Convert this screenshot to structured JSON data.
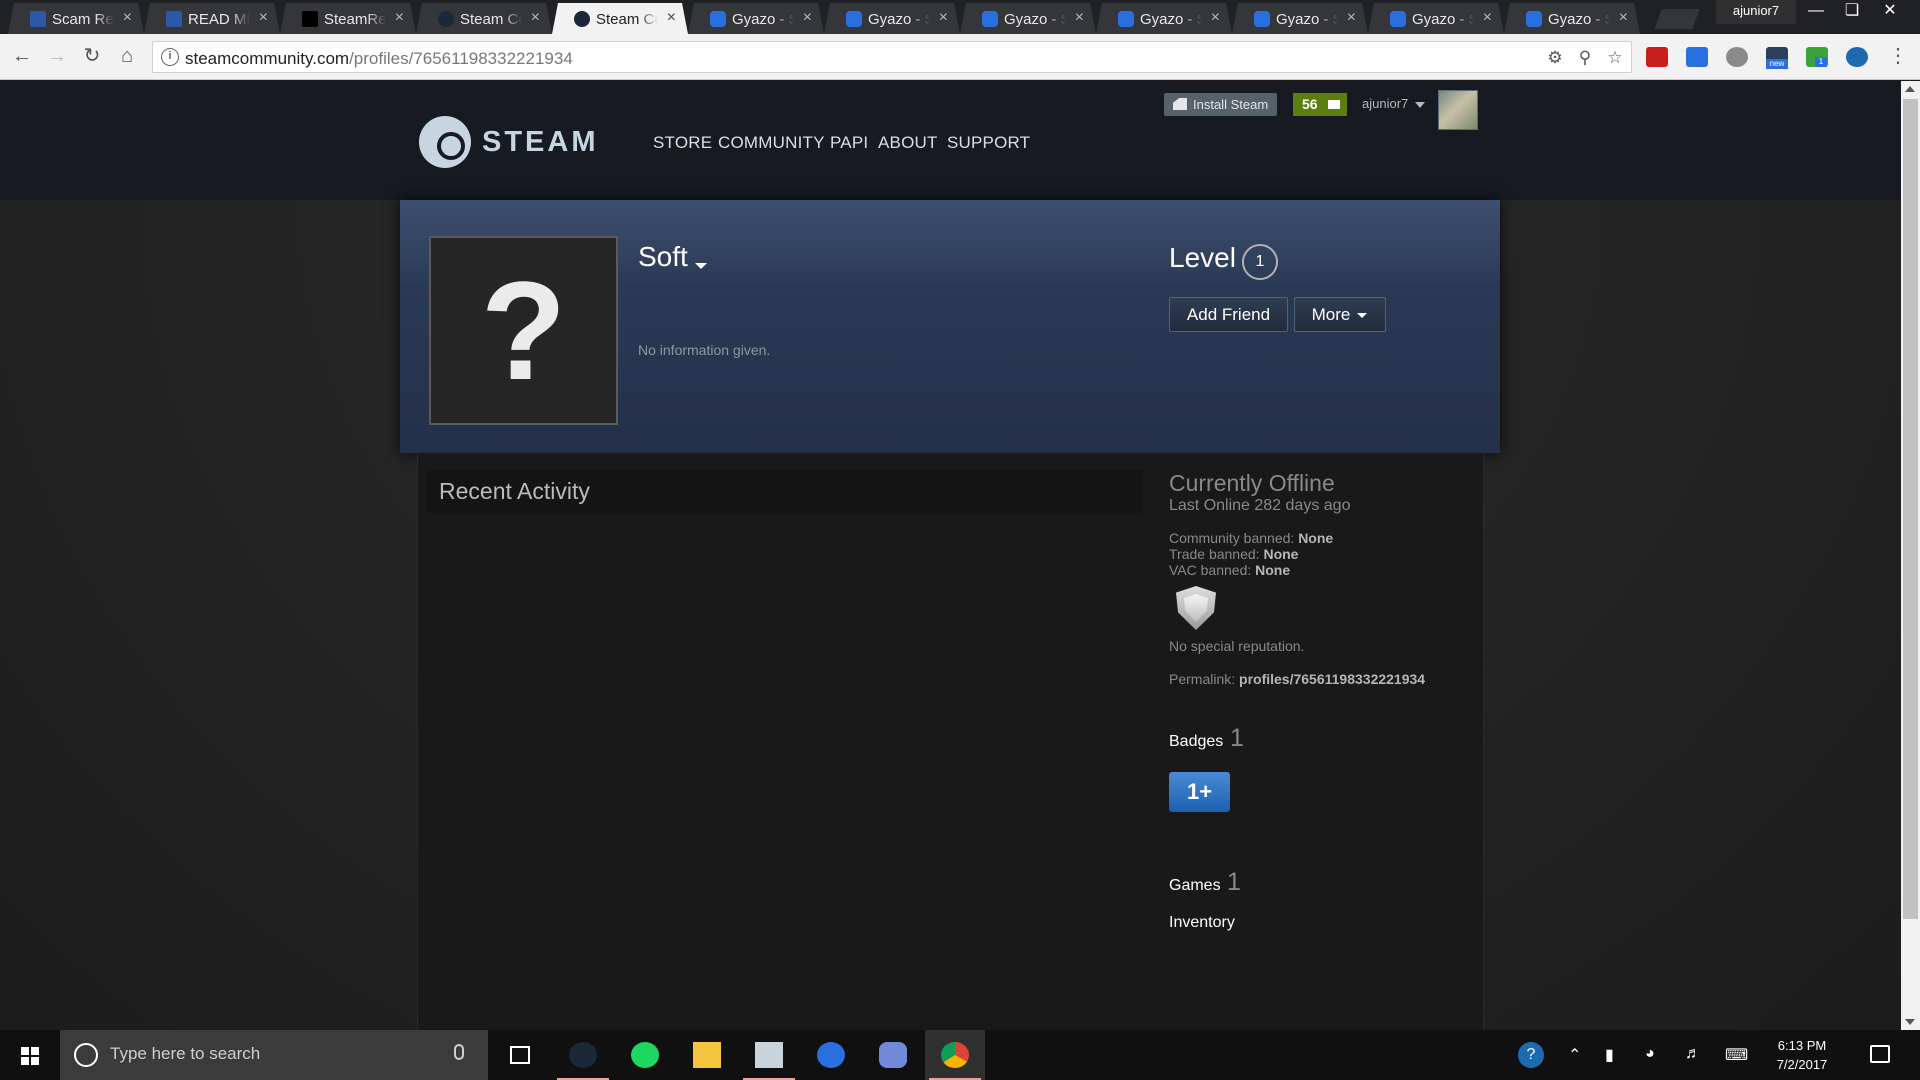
{
  "browser": {
    "tabs": [
      {
        "label": "Scam Rep",
        "icon": "sr"
      },
      {
        "label": "READ ME",
        "icon": "sr"
      },
      {
        "label": "SteamRep",
        "icon": "sr2"
      },
      {
        "label": "Steam Co",
        "icon": "steam"
      },
      {
        "label": "Steam Co",
        "icon": "steam",
        "active": true
      },
      {
        "label": "Gyazo - S",
        "icon": "gyazo"
      },
      {
        "label": "Gyazo - S",
        "icon": "gyazo"
      },
      {
        "label": "Gyazo - S",
        "icon": "gyazo"
      },
      {
        "label": "Gyazo - S",
        "icon": "gyazo"
      },
      {
        "label": "Gyazo - S",
        "icon": "gyazo"
      },
      {
        "label": "Gyazo - S",
        "icon": "gyazo"
      },
      {
        "label": "Gyazo - S",
        "icon": "gyazo"
      }
    ],
    "profile_name": "ajunior7",
    "url_host": "steamcommunity.com",
    "url_path": "/profiles/76561198332221934",
    "ext_badge_new": "new",
    "ext_badge_count": "1"
  },
  "steam_header": {
    "logo_text": "STEAM",
    "nav": [
      "STORE",
      "COMMUNITY",
      "PAPI",
      "ABOUT",
      "SUPPORT"
    ],
    "install_label": "Install Steam",
    "notification_count": "56",
    "account_name": "ajunior7"
  },
  "profile": {
    "avatar_placeholder": "?",
    "persona_name": "Soft",
    "summary": "No information given.",
    "level_label": "Level",
    "level": "1",
    "add_friend": "Add Friend",
    "more": "More"
  },
  "recent_activity": {
    "title": "Recent Activity"
  },
  "sidebar": {
    "status": "Currently Offline",
    "last_online": "Last Online 282 days ago",
    "community_banned_label": "Community banned:",
    "community_banned_value": "None",
    "trade_banned_label": "Trade banned:",
    "trade_banned_value": "None",
    "vac_banned_label": "VAC banned:",
    "vac_banned_value": "None",
    "reputation": "No special reputation.",
    "permalink_label": "Permalink:",
    "permalink_value": "profiles/76561198332221934",
    "badges_label": "Badges",
    "badges_count": "1",
    "badge_text": "1+",
    "games_label": "Games",
    "games_count": "1",
    "inventory_label": "Inventory"
  },
  "taskbar": {
    "search_placeholder": "Type here to search",
    "time": "6:13 PM",
    "date": "7/2/2017"
  },
  "colors": {
    "steam_header_bg": "#171a21",
    "profile_header_bg": "#2a3955",
    "notification_green": "#5c7e10"
  }
}
